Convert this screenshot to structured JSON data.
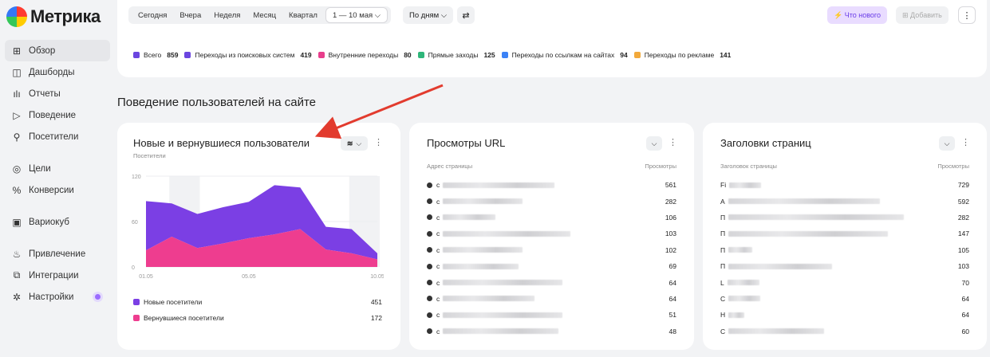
{
  "app": {
    "logo_text": "Метрика"
  },
  "sidebar": {
    "items": [
      {
        "label": "Обзор",
        "icon": "grid-icon",
        "glyph": "⊞",
        "active": true
      },
      {
        "label": "Дашборды",
        "icon": "dashboard-icon",
        "glyph": "◫"
      },
      {
        "label": "Отчеты",
        "icon": "bar-chart-icon",
        "glyph": "ılı"
      },
      {
        "label": "Поведение",
        "icon": "play-icon",
        "glyph": "▷"
      },
      {
        "label": "Посетители",
        "icon": "person-icon",
        "glyph": "⚲"
      },
      {
        "label": "Цели",
        "icon": "target-icon",
        "glyph": "◎"
      },
      {
        "label": "Конверсии",
        "icon": "percent-icon",
        "glyph": "%"
      },
      {
        "label": "Вариокуб",
        "icon": "cube-icon",
        "glyph": "▣"
      },
      {
        "label": "Привлечение",
        "icon": "flame-icon",
        "glyph": "♨"
      },
      {
        "label": "Интеграции",
        "icon": "puzzle-icon",
        "glyph": "⧉"
      },
      {
        "label": "Настройки",
        "icon": "gear-icon",
        "glyph": "✲"
      }
    ]
  },
  "toolbar": {
    "periods": [
      "Сегодня",
      "Вчера",
      "Неделя",
      "Месяц",
      "Квартал"
    ],
    "range": "1 — 10 мая ⌵",
    "grouping": "По дням ⌵",
    "filter_glyph": "⇄",
    "whats_new": "⚡ Что нового",
    "add": "⊞ Добавить",
    "more": "⋮"
  },
  "summary": {
    "items": [
      {
        "label": "Всего",
        "value": "859",
        "color": "#6b46e0"
      },
      {
        "label": "Переходы из поисковых систем",
        "value": "419",
        "color": "#6b46e0"
      },
      {
        "label": "Внутренние переходы",
        "value": "80",
        "color": "#e83e8c"
      },
      {
        "label": "Прямые заходы",
        "value": "125",
        "color": "#2fb67a"
      },
      {
        "label": "Переходы по ссылкам на сайтах",
        "value": "94",
        "color": "#3b82f6"
      },
      {
        "label": "Переходы по рекламе",
        "value": "141",
        "color": "#f2a93b"
      }
    ]
  },
  "section": {
    "title": "Поведение пользователей на сайте"
  },
  "chart_card": {
    "title": "Новые и вернувшиеся пользователи",
    "subtitle": "Посетители",
    "chevron": "⌵",
    "layers_glyph": "≋",
    "more": "⋮",
    "legend": [
      {
        "label": "Новые посетители",
        "value": "451",
        "color": "#7b3fe4"
      },
      {
        "label": "Вернувшиеся посетители",
        "value": "172",
        "color": "#ee3d8f"
      }
    ]
  },
  "chart_data": {
    "type": "area",
    "x": [
      "01.05",
      "02.05",
      "03.05",
      "04.05",
      "05.05",
      "06.05",
      "07.05",
      "08.05",
      "09.05",
      "10.05"
    ],
    "x_ticks": [
      "01.05",
      "05.05",
      "10.05"
    ],
    "y_ticks": [
      "0",
      "60",
      "120"
    ],
    "ylim": [
      0,
      120
    ],
    "stacked": true,
    "series": [
      {
        "name": "Новые посетители",
        "color": "#7b3fe4",
        "values": [
          65,
          44,
          45,
          48,
          48,
          65,
          55,
          30,
          32,
          8
        ]
      },
      {
        "name": "Вернувшиеся посетители",
        "color": "#ee3d8f",
        "values": [
          22,
          40,
          25,
          31,
          38,
          43,
          50,
          23,
          18,
          10
        ]
      }
    ]
  },
  "urls_card": {
    "title": "Просмотры URL",
    "col_left": "Адрес страницы",
    "col_right": "Просмотры",
    "chevron": "⌵",
    "more": "⋮",
    "rows": [
      {
        "text": "c",
        "value": "561"
      },
      {
        "text": "c",
        "value": "282"
      },
      {
        "text": "c",
        "value": "106"
      },
      {
        "text": "c",
        "value": "103"
      },
      {
        "text": "c",
        "value": "102"
      },
      {
        "text": "c",
        "value": "69"
      },
      {
        "text": "c",
        "value": "64"
      },
      {
        "text": "c",
        "value": "64"
      },
      {
        "text": "c",
        "value": "51"
      },
      {
        "text": "c",
        "value": "48"
      }
    ]
  },
  "titles_card": {
    "title": "Заголовки страниц",
    "col_left": "Заголовок страницы",
    "col_right": "Просмотры",
    "chevron": "⌵",
    "more": "⋮",
    "rows": [
      {
        "text": "Fi",
        "value": "729"
      },
      {
        "text": "A",
        "value": "592"
      },
      {
        "text": "П",
        "value": "282"
      },
      {
        "text": "П",
        "value": "147"
      },
      {
        "text": "П",
        "value": "105"
      },
      {
        "text": "П",
        "value": "103"
      },
      {
        "text": "L",
        "value": "70"
      },
      {
        "text": "C",
        "value": "64"
      },
      {
        "text": "H",
        "value": "64"
      },
      {
        "text": "C",
        "value": "60"
      }
    ]
  }
}
